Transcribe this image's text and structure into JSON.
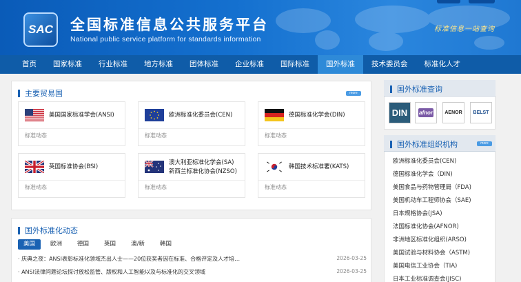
{
  "header": {
    "logo_text": "SAC",
    "title_cn": "全国标准信息公共服务平台",
    "title_en": "National public service platform  for standards information",
    "slogan": "标准信息一站查询"
  },
  "nav": [
    {
      "label": "首页"
    },
    {
      "label": "国家标准"
    },
    {
      "label": "行业标准"
    },
    {
      "label": "地方标准"
    },
    {
      "label": "团体标准"
    },
    {
      "label": "企业标准"
    },
    {
      "label": "国际标准"
    },
    {
      "label": "国外标准",
      "active": true
    },
    {
      "label": "技术委员会"
    },
    {
      "label": "标准化人才"
    }
  ],
  "trade": {
    "title": "主要贸易国",
    "more": "more",
    "cards": [
      {
        "flag": "us-flag-icon",
        "name": "美国国家标准学会(ANSI)",
        "tag": "标准动态"
      },
      {
        "flag": "eu-flag-icon",
        "name": "欧洲标准化委员会(CEN)",
        "tag": "标准动态"
      },
      {
        "flag": "de-flag-icon",
        "name": "德国标准化学会(DIN)",
        "tag": "标准动态"
      },
      {
        "flag": "gb-flag-icon",
        "name": "英国标准协会(BSI)",
        "tag": "标准动态"
      },
      {
        "flag": "au-flag-icon",
        "name": "澳大利亚标准化学会(SA)",
        "name2": "新西兰标准化协会(NZSO)",
        "tag": "标准动态"
      },
      {
        "flag": "kr-flag-icon",
        "name": "韩国技术标准署(KATS)",
        "tag": "标准动态"
      }
    ]
  },
  "dynamics": {
    "title": "国外标准化动态",
    "tabs": [
      "美国",
      "欧洲",
      "德国",
      "英国",
      "澳/新",
      "韩国"
    ],
    "news": [
      {
        "text": "· 庆典之夜：ANSI表彰标准化领域杰出人士——20位获奖者因在标准、合格评定及人才培…",
        "date": "2026-03-25"
      },
      {
        "text": "· ANSI法律问题论坛探讨放松监管、版权和人工智能以及与标准化的交叉领域",
        "date": "2026-03-25"
      }
    ]
  },
  "query": {
    "title": "国外标准查询",
    "logos": [
      "DIN",
      "afnor",
      "AENOR",
      "BELST"
    ]
  },
  "orgs": {
    "title": "国外标准组织机构",
    "more": "more",
    "items": [
      "欧洲标准化委员会(CEN)",
      "德国标准化学会（DIN)",
      "美国食品与药物管理局（FDA)",
      "美国机动车工程师协会（SAE)",
      "日本规格协会(JSA)",
      "法国标准化协会(AFNOR)",
      "非洲地区标准化组织(ARSO)",
      "美国试验与材料协会（ASTM)",
      "美国电信工业协会（TIA)",
      "日本工业标准调查会(JISC)"
    ]
  },
  "colors": {
    "brand": "#1a62b3",
    "nav": "#0f5ca8",
    "nav_active": "#2e8ad8"
  }
}
